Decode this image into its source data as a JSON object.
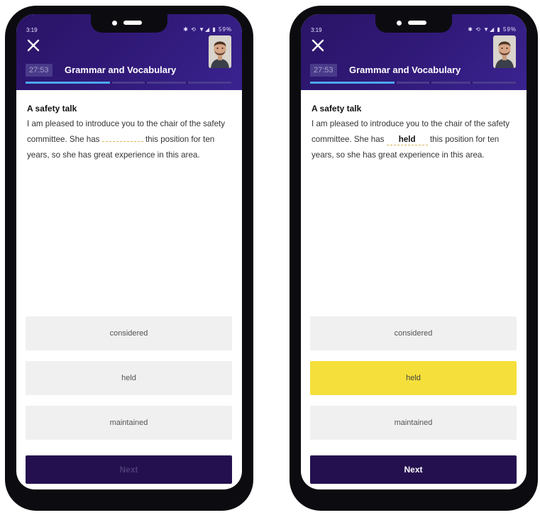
{
  "colors": {
    "header": "#311a7a",
    "progress": "#4aa8f0",
    "selected_option": "#f5df3a",
    "next_button": "#24104f",
    "option_bg": "#f0f0f0"
  },
  "screens": [
    {
      "status": {
        "time": "3:19",
        "icons": "✱ ⟲ ▼◢ ▮ 59%"
      },
      "header": {
        "timer": "27:53",
        "title": "Grammar and Vocabulary",
        "close_icon": "close-icon",
        "progress": 0.41
      },
      "question": {
        "title": "A safety talk",
        "text_before": "I am pleased to introduce you to the chair of the safety committee. She has",
        "blank": "",
        "text_after": "this position for ten years, so she has great experience in this area."
      },
      "options": [
        "considered",
        "held",
        "maintained"
      ],
      "selected_index": null,
      "next_label": "Next",
      "next_enabled": false
    },
    {
      "status": {
        "time": "3:19",
        "icons": "✱ ⟲ ▼◢ ▮ 59%"
      },
      "header": {
        "timer": "27:53",
        "title": "Grammar and Vocabulary",
        "close_icon": "close-icon",
        "progress": 0.41
      },
      "question": {
        "title": "A safety talk",
        "text_before": "I am pleased to introduce you to the chair of the safety committee. She has",
        "blank": "held",
        "text_after": "this position for ten years, so she has great experience in this area."
      },
      "options": [
        "considered",
        "held",
        "maintained"
      ],
      "selected_index": 1,
      "next_label": "Next",
      "next_enabled": true
    }
  ]
}
